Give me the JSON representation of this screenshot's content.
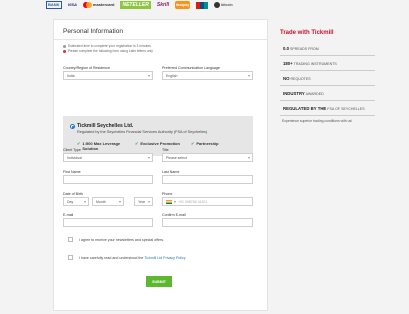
{
  "payments": {
    "bank": "BANK",
    "visa": "VISA",
    "mastercard": "mastercard",
    "neteller": "NETELLER",
    "skrill": "Skrill",
    "fasapay": "fasapay",
    "bitcoin": "bitcoin"
  },
  "form": {
    "title": "Personal Information",
    "notice_time": "Estimated time to complete your registration is 3 minutes",
    "notice_latin": "Please complete the following form using Latin letters only",
    "country_label": "Country/Region of Residence",
    "country_value": "India",
    "language_label": "Preferred Communication Language",
    "language_value": "English",
    "regulator": {
      "name": "Tickmill Seychelles Ltd.",
      "sub": "Regulated by the Seychelles Financial Services Authority (FSA of Seychelles)",
      "features": [
        "1:500 Max Leverage Solution",
        "Exclusive Promotion",
        "Partnership"
      ]
    },
    "client_type_label": "Client Type",
    "client_type_value": "Individual",
    "title_label": "Title",
    "title_placeholder": "Please select",
    "first_name_label": "First Name",
    "last_name_label": "Last Name",
    "dob_label": "Date of Birth",
    "dob_day": "Day",
    "dob_month": "Month",
    "dob_year": "Year",
    "phone_label": "Phone",
    "phone_placeholder": "+91 098765 04321",
    "email_label": "E-mail",
    "confirm_email_label": "Confirm E-mail",
    "newsletter_text": "I agree to receive your newsletters and special offers.",
    "privacy_text": "I have carefully read and understood the",
    "privacy_link": "Tickmill Ltd Privacy Policy",
    "submit_label": "SUBMIT"
  },
  "sidebar": {
    "title": "Trade with Tickmill",
    "rows": [
      {
        "bold": "0.0",
        "text": "SPREADS FROM"
      },
      {
        "bold": "180+",
        "text": "TRADING INSTRUMENTS"
      },
      {
        "bold": "NO",
        "text": "REQUOTES"
      },
      {
        "bold": "INDUSTRY",
        "text": "AWARDED"
      },
      {
        "bold": "REGULATED BY THE",
        "text": "FSA OF SEYCHELLES"
      }
    ],
    "footer": "Experience superior trading conditions with us!"
  },
  "colors": {
    "accent_red": "#c8102e",
    "submit_green": "#5cb82e",
    "link_blue": "#1e73be"
  }
}
